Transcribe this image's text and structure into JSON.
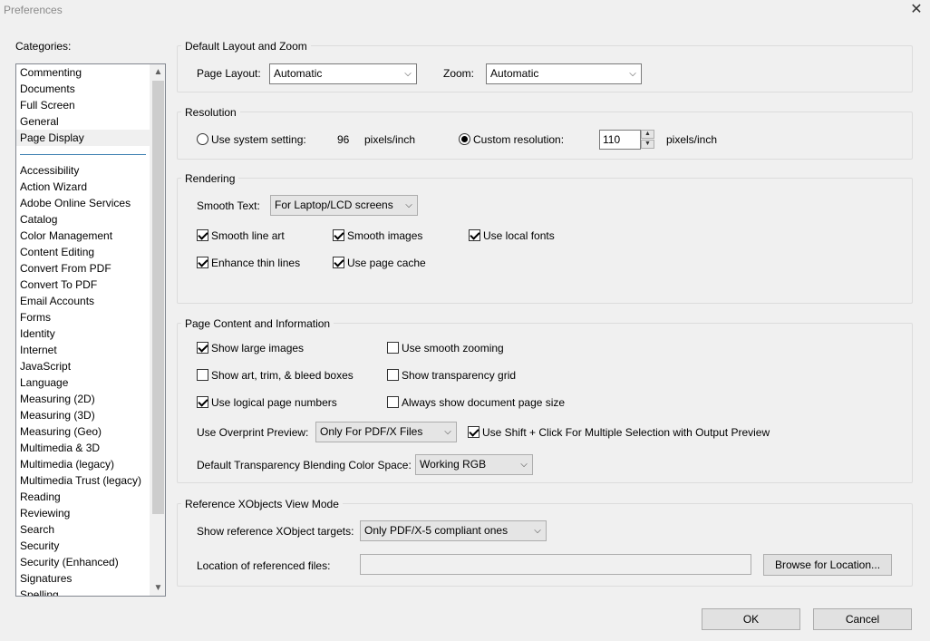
{
  "window": {
    "title": "Preferences",
    "close_icon": "close-icon"
  },
  "categories": {
    "label": "Categories:",
    "items": [
      {
        "label": "Commenting"
      },
      {
        "label": "Documents"
      },
      {
        "label": "Full Screen"
      },
      {
        "label": "General"
      },
      {
        "label": "Page Display",
        "selected": true
      },
      {
        "separator": true
      },
      {
        "label": "Accessibility"
      },
      {
        "label": "Action Wizard"
      },
      {
        "label": "Adobe Online Services"
      },
      {
        "label": "Catalog"
      },
      {
        "label": "Color Management"
      },
      {
        "label": "Content Editing"
      },
      {
        "label": "Convert From PDF"
      },
      {
        "label": "Convert To PDF"
      },
      {
        "label": "Email Accounts"
      },
      {
        "label": "Forms"
      },
      {
        "label": "Identity"
      },
      {
        "label": "Internet"
      },
      {
        "label": "JavaScript"
      },
      {
        "label": "Language"
      },
      {
        "label": "Measuring (2D)"
      },
      {
        "label": "Measuring (3D)"
      },
      {
        "label": "Measuring (Geo)"
      },
      {
        "label": "Multimedia & 3D"
      },
      {
        "label": "Multimedia (legacy)"
      },
      {
        "label": "Multimedia Trust (legacy)"
      },
      {
        "label": "Reading"
      },
      {
        "label": "Reviewing"
      },
      {
        "label": "Search"
      },
      {
        "label": "Security"
      },
      {
        "label": "Security (Enhanced)"
      },
      {
        "label": "Signatures"
      },
      {
        "label": "Spelling"
      }
    ]
  },
  "layout_zoom": {
    "title": "Default Layout and Zoom",
    "page_layout_label": "Page Layout:",
    "page_layout_value": "Automatic",
    "zoom_label": "Zoom:",
    "zoom_value": "Automatic"
  },
  "resolution": {
    "title": "Resolution",
    "system_label": "Use system setting:",
    "system_value": "96",
    "system_unit": "pixels/inch",
    "system_selected": false,
    "custom_label": "Custom resolution:",
    "custom_value": "110",
    "custom_unit": "pixels/inch",
    "custom_selected": true
  },
  "rendering": {
    "title": "Rendering",
    "smooth_text_label": "Smooth Text:",
    "smooth_text_value": "For Laptop/LCD screens",
    "smooth_line_art": {
      "label": "Smooth line art",
      "checked": true
    },
    "smooth_images": {
      "label": "Smooth images",
      "checked": true
    },
    "use_local_fonts": {
      "label": "Use local fonts",
      "checked": true
    },
    "enhance_thin_lines": {
      "label": "Enhance thin lines",
      "checked": true
    },
    "use_page_cache": {
      "label": "Use page cache",
      "checked": true
    }
  },
  "page_content": {
    "title": "Page Content and Information",
    "show_large_images": {
      "label": "Show large images",
      "checked": true
    },
    "use_smooth_zooming": {
      "label": "Use smooth zooming",
      "checked": false
    },
    "show_art_trim": {
      "label": "Show art, trim, & bleed boxes",
      "checked": false
    },
    "show_transparency_grid": {
      "label": "Show transparency grid",
      "checked": false
    },
    "use_logical_page_numbers": {
      "label": "Use logical page numbers",
      "checked": true
    },
    "always_show_page_size": {
      "label": "Always show document page size",
      "checked": false
    },
    "overprint_label": "Use Overprint Preview:",
    "overprint_value": "Only For PDF/X Files",
    "shift_click": {
      "label": "Use Shift + Click For Multiple Selection with Output Preview",
      "checked": true
    },
    "blending_label": "Default Transparency Blending Color Space:",
    "blending_value": "Working RGB"
  },
  "xobjects": {
    "title": "Reference XObjects View Mode",
    "targets_label": "Show reference XObject targets:",
    "targets_value": "Only PDF/X-5 compliant ones",
    "location_label": "Location of referenced files:",
    "location_value": "",
    "browse_label": "Browse for Location..."
  },
  "footer": {
    "ok_label": "OK",
    "cancel_label": "Cancel"
  }
}
